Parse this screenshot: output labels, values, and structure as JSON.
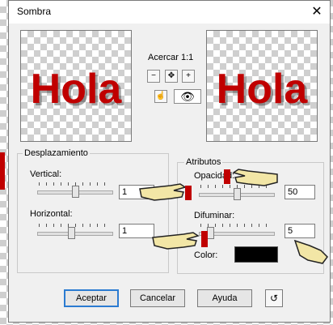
{
  "window": {
    "title": "Sombra",
    "close_symbol": "✕"
  },
  "preview": {
    "left_text": "Hola",
    "right_text": "Hola"
  },
  "zoom": {
    "label": "Acercar 1:1",
    "zoom_out_symbol": "−",
    "pan_symbol": "✥",
    "zoom_in_symbol": "+",
    "hand_symbol": "☝",
    "eye_symbol": "👁"
  },
  "displacement": {
    "title": "Desplazamiento",
    "vertical_label": "Vertical:",
    "vertical_value": "1",
    "horizontal_label": "Horizontal:",
    "horizontal_value": "1"
  },
  "attributes": {
    "title": "Atributos",
    "opacity_label": "Opacidad:",
    "opacity_value": "50",
    "blur_label": "Difuminar:",
    "blur_value": "5",
    "color_label": "Color:",
    "color_value": "#000000"
  },
  "buttons": {
    "accept": "Aceptar",
    "cancel": "Cancelar",
    "help": "Ayuda",
    "reset_symbol": "↺"
  },
  "colors": {
    "text_red": "#c00000",
    "accent_blue": "#2b7bd1"
  },
  "sliders": {
    "vertical": 0.5,
    "horizontal": 0.45,
    "opacity": 0.5,
    "blur": 0.12
  }
}
